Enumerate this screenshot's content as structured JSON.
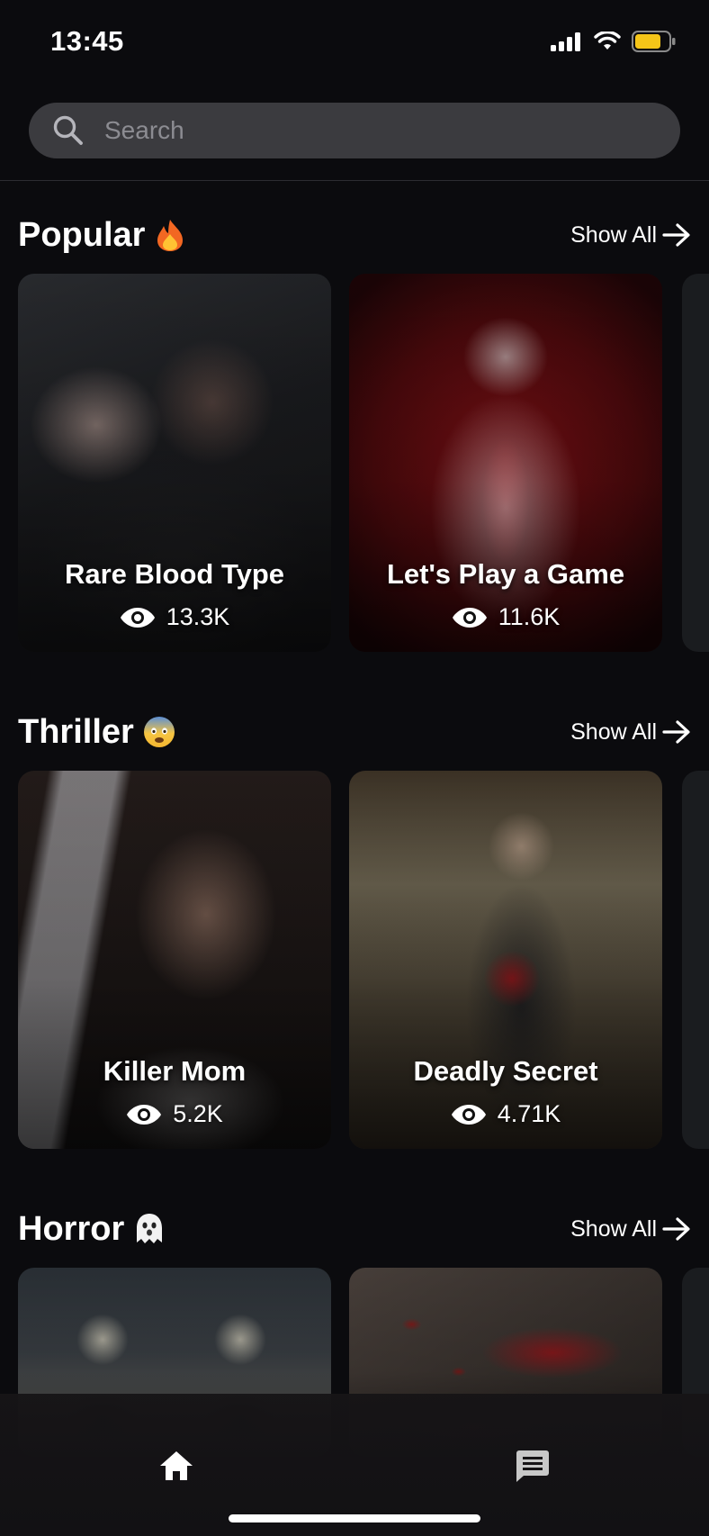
{
  "status_bar": {
    "time": "13:45",
    "icons": [
      "signal-icon",
      "wifi-icon",
      "battery-icon"
    ],
    "battery_color": "#f5c518"
  },
  "search": {
    "placeholder": "Search",
    "value": ""
  },
  "sections": [
    {
      "title": "Popular",
      "emoji": "fire-emoji",
      "show_all_label": "Show All",
      "cards": [
        {
          "title": "Rare Blood Type",
          "views": "13.3K"
        },
        {
          "title": "Let's Play a Game",
          "views": "11.6K"
        }
      ]
    },
    {
      "title": "Thriller",
      "emoji": "fearful-face-emoji",
      "show_all_label": "Show All",
      "cards": [
        {
          "title": "Killer Mom",
          "views": "5.2K"
        },
        {
          "title": "Deadly Secret",
          "views": "4.71K"
        }
      ]
    },
    {
      "title": "Horror",
      "emoji": "ghost-emoji",
      "show_all_label": "Show All",
      "cards": [
        {
          "title": "",
          "views": ""
        },
        {
          "title": "",
          "views": ""
        }
      ]
    }
  ],
  "bottom_nav": {
    "items": [
      "home-icon",
      "chat-icon"
    ]
  },
  "colors": {
    "background": "#0b0b0e",
    "search_bg": "#3b3b3f",
    "accent_red": "#a3121c"
  }
}
